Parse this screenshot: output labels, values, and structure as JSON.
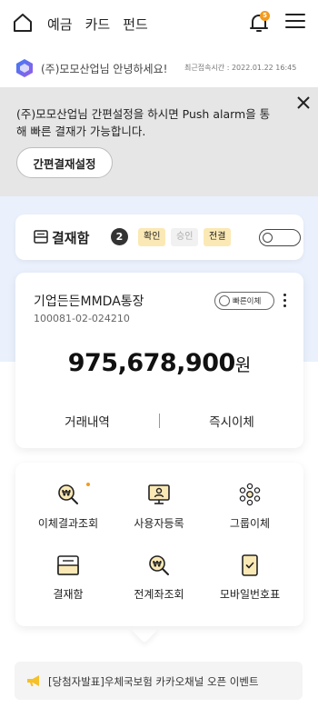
{
  "header": {
    "nav": [
      "예금",
      "카드",
      "펀드"
    ],
    "notification_count": "5"
  },
  "greeting": {
    "text": "(주)모모산업님 안녕하세요!",
    "last_login": "최근접속시간 : 2022.01.22 16:45"
  },
  "banner": {
    "message": "(주)모모산업님 간편설정을 하시면 Push alarm을 통해 빠른 결재가 가능합니다.",
    "button_label": "간편결재설정"
  },
  "approval": {
    "title": "결재함",
    "count": "2",
    "chips": [
      "확인",
      "승인",
      "전결"
    ]
  },
  "account": {
    "name": "기업든든MMDA통장",
    "number": "100081-02-024210",
    "fast_transfer_label": "빠른이체",
    "balance": "975,678,900",
    "currency": "원",
    "actions": [
      "거래내역",
      "즉시이체"
    ]
  },
  "menu": {
    "items": [
      {
        "label": "이체결과조회",
        "icon": "search-won-icon"
      },
      {
        "label": "사용자등록",
        "icon": "user-monitor-icon"
      },
      {
        "label": "그룹이체",
        "icon": "group-network-icon"
      },
      {
        "label": "결재함",
        "icon": "tray-icon"
      },
      {
        "label": "전계좌조회",
        "icon": "search-won-icon"
      },
      {
        "label": "모바일번호표",
        "icon": "mobile-ticket-icon"
      }
    ]
  },
  "event": {
    "text": "[당첨자발표]우체국보험 카카오채널 오픈 이벤트"
  },
  "colors": {
    "accent": "#f39a1b",
    "chip_bg": "#fbe9b5",
    "banner_bg": "#e6e6e6",
    "blue_bg": "#eaf1fd"
  }
}
